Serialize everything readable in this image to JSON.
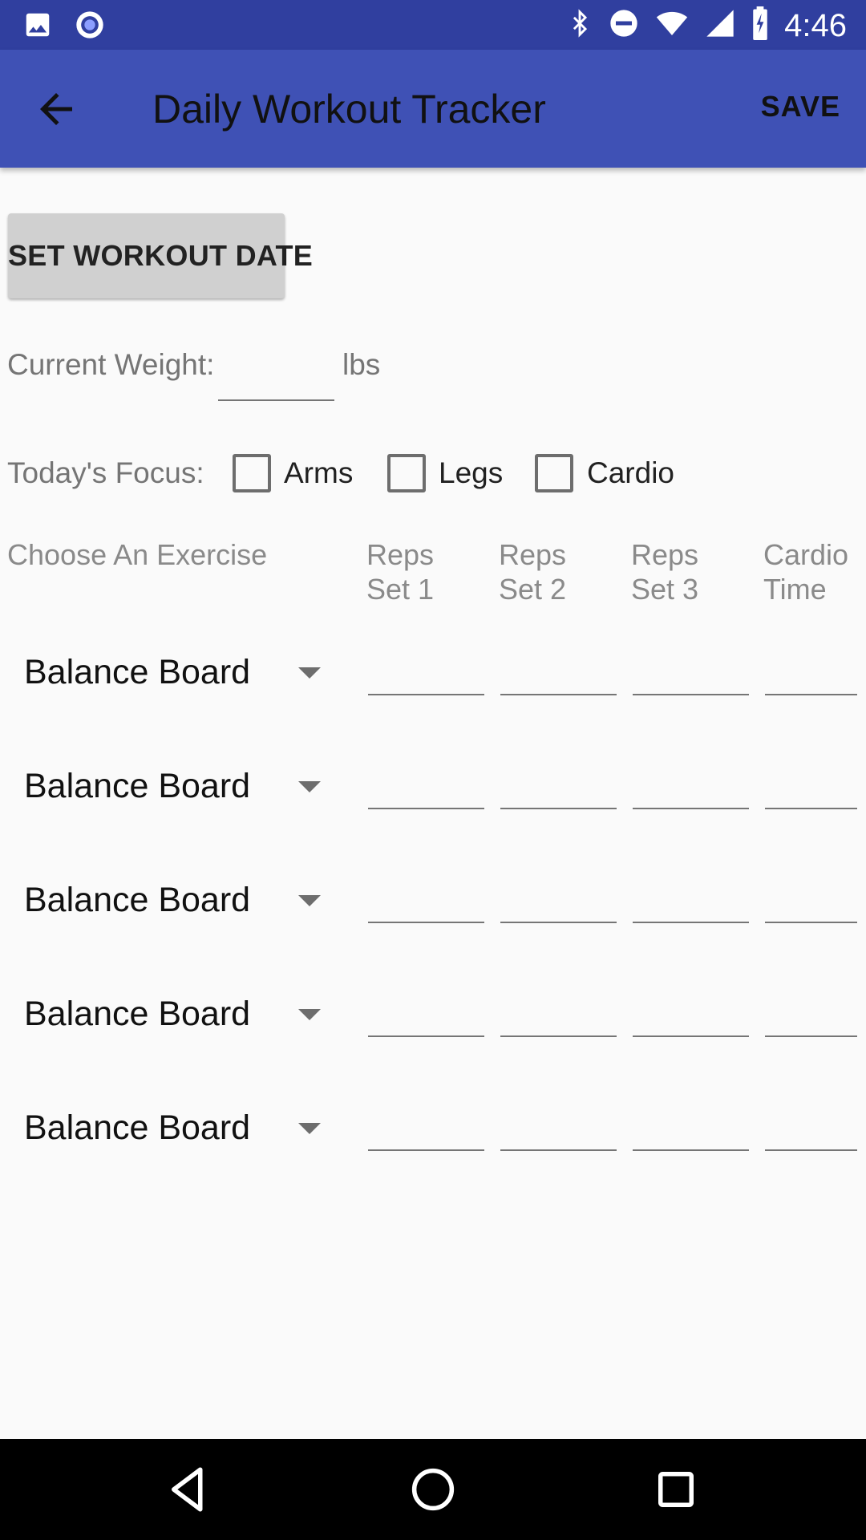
{
  "status_bar": {
    "time": "4:46",
    "left_icons": [
      "image-icon",
      "record-icon"
    ],
    "right_icons": [
      "bluetooth-icon",
      "do-not-disturb-icon",
      "wifi-icon",
      "cellular-signal-icon",
      "battery-charging-icon"
    ]
  },
  "app_bar": {
    "title": "Daily Workout Tracker",
    "save_label": "SAVE",
    "back_icon": "arrow-back-icon",
    "background": "#3f51b5",
    "status_background": "#303f9f"
  },
  "date_button": {
    "label": "SET WORKOUT DATE"
  },
  "weight": {
    "label": "Current Weight:",
    "value": "",
    "unit": "lbs"
  },
  "focus": {
    "label": "Today's Focus:",
    "options": [
      {
        "label": "Arms",
        "checked": false
      },
      {
        "label": "Legs",
        "checked": false
      },
      {
        "label": "Cardio",
        "checked": false
      }
    ]
  },
  "table": {
    "headers": [
      {
        "line1": "Choose An Exercise",
        "line2": ""
      },
      {
        "line1": "Reps",
        "line2": "Set 1"
      },
      {
        "line1": "Reps",
        "line2": "Set 2"
      },
      {
        "line1": "Reps",
        "line2": "Set 3"
      },
      {
        "line1": "Cardio",
        "line2": "Time"
      }
    ],
    "rows": [
      {
        "exercise": "Balance Board",
        "set1": "",
        "set2": "",
        "set3": "",
        "cardio_time": ""
      },
      {
        "exercise": "Balance Board",
        "set1": "",
        "set2": "",
        "set3": "",
        "cardio_time": ""
      },
      {
        "exercise": "Balance Board",
        "set1": "",
        "set2": "",
        "set3": "",
        "cardio_time": ""
      },
      {
        "exercise": "Balance Board",
        "set1": "",
        "set2": "",
        "set3": "",
        "cardio_time": ""
      },
      {
        "exercise": "Balance Board",
        "set1": "",
        "set2": "",
        "set3": "",
        "cardio_time": ""
      }
    ]
  },
  "nav_bar": {
    "icons": [
      "back-triangle-icon",
      "home-circle-icon",
      "recents-square-icon"
    ]
  }
}
